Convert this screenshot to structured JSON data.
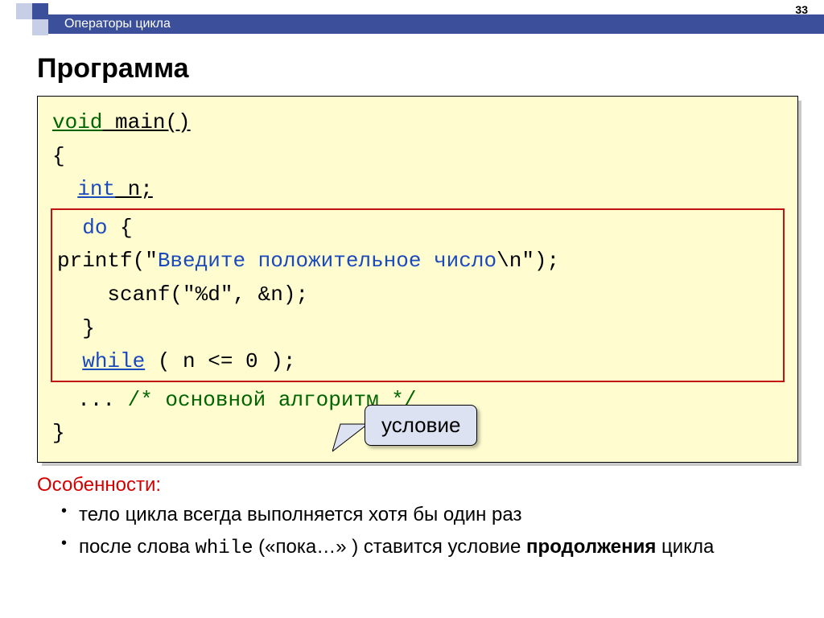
{
  "header": {
    "breadcrumb": "Операторы цикла",
    "page_number": "33"
  },
  "title": "Программа",
  "code": {
    "l1_void": "void",
    "l1_rest": " main()",
    "l2": "{",
    "l3_int": "int",
    "l3_rest": " n;",
    "l4_do": "do",
    "l4_rest": " {",
    "l5a": "    printf(\"",
    "l5b": "Введите положительное число",
    "l5c": "\\n\");",
    "l6": "    scanf(\"%d\", &n);",
    "l7": "  }",
    "l8_while": "while",
    "l8_rest": " ( n <= 0 );",
    "l9a": "  ... ",
    "l9b": "/* основной алгоритм */",
    "l10": "}"
  },
  "callout": "условие",
  "features": {
    "title": "Особенности:",
    "item1": "тело цикла всегда выполняется хотя бы один раз",
    "item2a": "после слова ",
    "item2b": "while",
    "item2c": " («пока…» ) ставится условие ",
    "item2d": "продолжения",
    "item2e": " цикла"
  }
}
